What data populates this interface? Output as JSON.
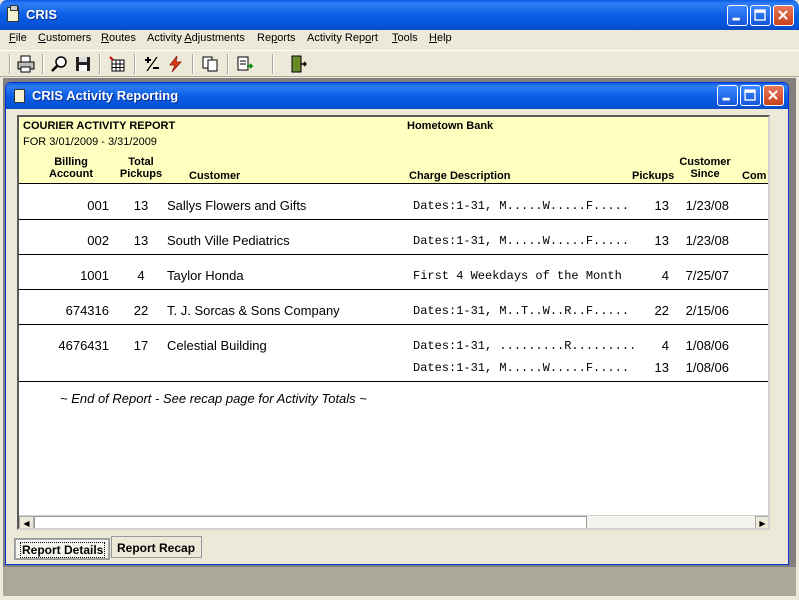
{
  "app": {
    "title": "CRIS"
  },
  "menu": [
    {
      "u": "F",
      "rest": "ile"
    },
    {
      "u": "C",
      "rest": "ustomers"
    },
    {
      "u": "R",
      "rest": "outes"
    },
    {
      "pre": "Activity ",
      "u": "A",
      "rest": "djustments"
    },
    {
      "pre": "Re",
      "u": "p",
      "rest": "orts"
    },
    {
      "pre": "Activity Rep",
      "u": "o",
      "rest": "rt"
    },
    {
      "u": "T",
      "rest": "ools"
    },
    {
      "u": "H",
      "rest": "elp"
    }
  ],
  "toolbar_icons": [
    "print-icon",
    "preview-icon",
    "save-icon",
    "grid-icon",
    "plus-minus-icon",
    "lightning-icon",
    "copy-icon",
    "export-icon",
    "exit-icon"
  ],
  "child_window": {
    "title": "CRIS Activity Reporting"
  },
  "report": {
    "title": "COURIER ACTIVITY REPORT",
    "client": "Hometown Bank",
    "period": "FOR  3/01/2009  -  3/31/2009",
    "columns": {
      "billing_1": "Billing",
      "billing_2": "Account",
      "total_1": "Total",
      "total_2": "Pickups",
      "customer": "Customer",
      "charge": "Charge Description",
      "pickups": "Pickups",
      "since_1": "Customer",
      "since_2": "Since",
      "com": "Com"
    },
    "rows": [
      {
        "account": "001",
        "total": "13",
        "customer": "Sallys Flowers and Gifts",
        "lines": [
          {
            "charge": "Dates:1-31, M.....W.....F.....",
            "pickups": "13",
            "since": "1/23/08"
          }
        ]
      },
      {
        "account": "002",
        "total": "13",
        "customer": "South Ville Pediatrics",
        "lines": [
          {
            "charge": "Dates:1-31, M.....W.....F.....",
            "pickups": "13",
            "since": "1/23/08"
          }
        ]
      },
      {
        "account": "1001",
        "total": "4",
        "customer": "Taylor Honda",
        "lines": [
          {
            "charge": "First 4 Weekdays of the Month",
            "pickups": "4",
            "since": "7/25/07"
          }
        ]
      },
      {
        "account": "674316",
        "total": "22",
        "customer": "T. J. Sorcas & Sons Company",
        "lines": [
          {
            "charge": "Dates:1-31, M..T..W..R..F.....",
            "pickups": "22",
            "since": "2/15/06"
          }
        ]
      },
      {
        "account": "4676431",
        "total": "17",
        "customer": "Celestial Building",
        "lines": [
          {
            "charge": "Dates:1-31, .........R.........",
            "pickups": "4",
            "since": "1/08/06"
          },
          {
            "charge": "Dates:1-31, M.....W.....F.....",
            "pickups": "13",
            "since": "1/08/06"
          }
        ]
      }
    ],
    "footer": "~ End of Report - See recap page for Activity Totals ~"
  },
  "tabs": [
    {
      "label": "Report Details",
      "active": true
    },
    {
      "label": "Report Recap",
      "active": false
    }
  ]
}
